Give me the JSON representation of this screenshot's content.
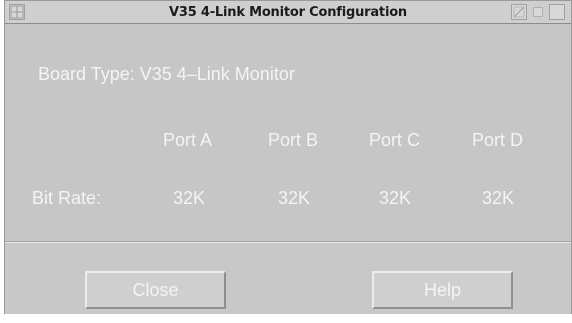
{
  "window": {
    "title": "V35 4-Link Monitor Configuration",
    "menu_icon": "window-menu-icon",
    "controls": [
      "minimize-icon",
      "restore-icon",
      "close-icon"
    ]
  },
  "board": {
    "label": "Board Type: V35 4–Link Monitor"
  },
  "ports": {
    "headers": [
      "Port A",
      "Port B",
      "Port C",
      "Port D"
    ]
  },
  "bit_rate": {
    "label": "Bit Rate:",
    "values": [
      "32K",
      "32K",
      "32K",
      "32K"
    ]
  },
  "buttons": {
    "close": "Close",
    "help": "Help"
  },
  "colors": {
    "window_bg": "#c9c9c9",
    "text": "#f4f4f4",
    "title_text": "#1b1b1b"
  }
}
